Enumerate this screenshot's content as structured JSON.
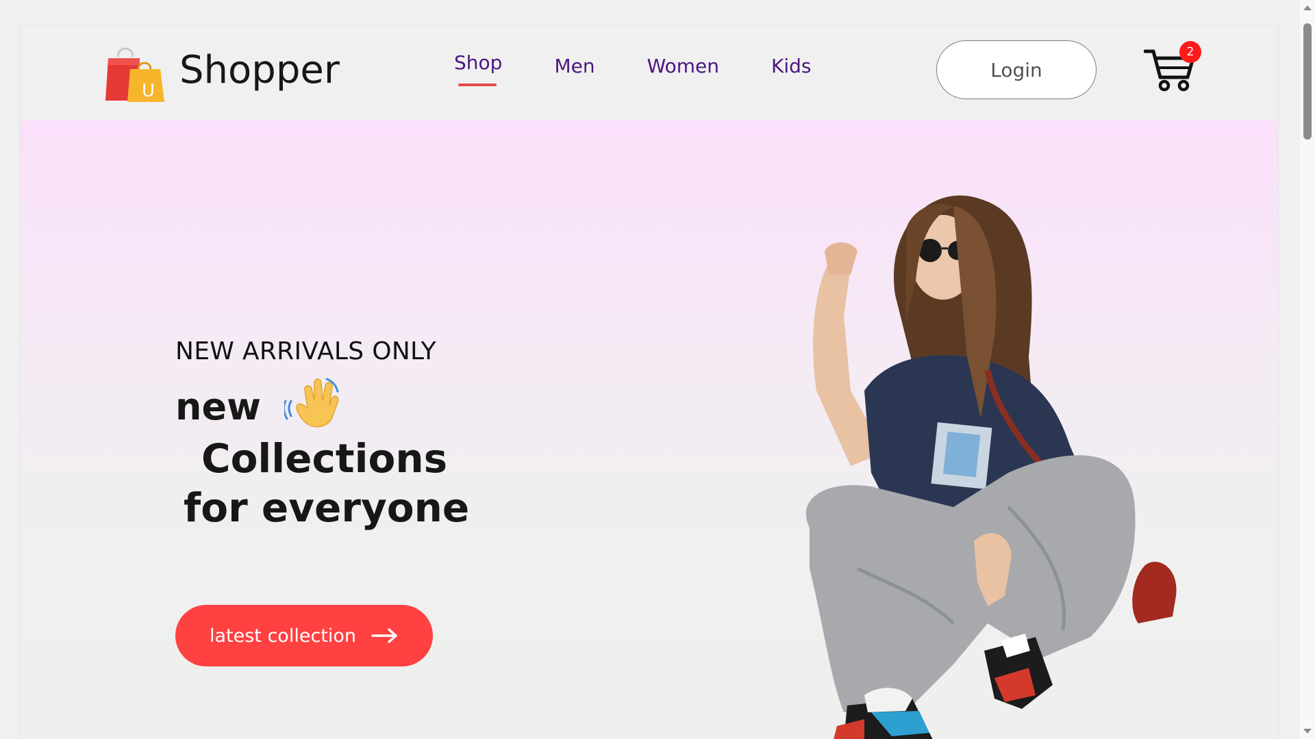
{
  "brand": {
    "name": "Shopper",
    "logo_icon": "shopping-bags-icon",
    "logo_letter": "U"
  },
  "nav": {
    "items": [
      {
        "label": "Shop",
        "active": true
      },
      {
        "label": "Men",
        "active": false
      },
      {
        "label": "Women",
        "active": false
      },
      {
        "label": "Kids",
        "active": false
      }
    ]
  },
  "header": {
    "login_label": "Login",
    "cart_icon": "cart-icon",
    "cart_count": "2"
  },
  "hero": {
    "tagline": "NEW ARRIVALS ONLY",
    "line1": "new",
    "hand_icon": "waving-hand-icon",
    "line2": "Collections",
    "line3": "for everyone",
    "cta_label": "latest collection",
    "cta_icon": "arrow-right-icon",
    "image": "woman-model-image"
  },
  "colors": {
    "accent": "#ff4141",
    "nav_text": "#4b167f",
    "active_underline": "#e54a4a",
    "badge": "#ff1a1a",
    "hero_top": "#fbe0fb",
    "hero_bottom": "#eef0ee"
  }
}
